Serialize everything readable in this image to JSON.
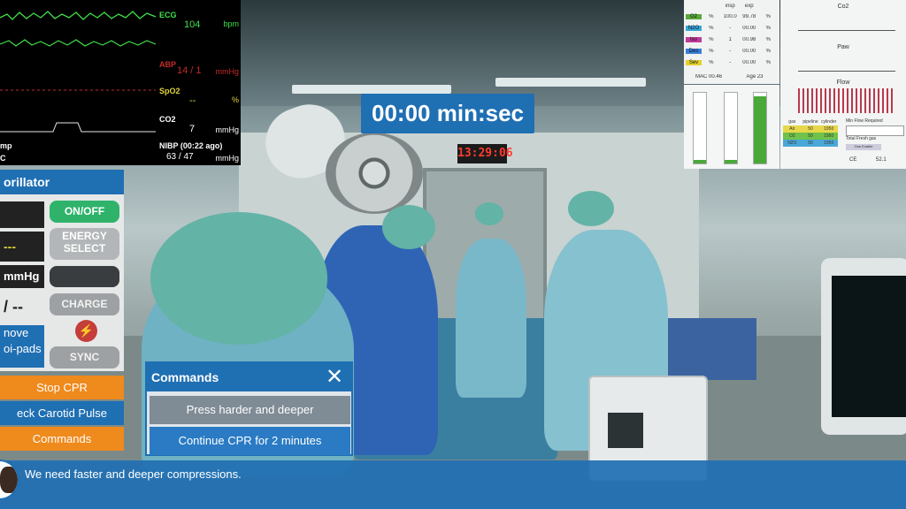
{
  "timer": {
    "text": "00:00 min:sec"
  },
  "wall_clock": "13:29:06",
  "patient_monitor": {
    "ecg": {
      "label": "ECG",
      "value": "104",
      "unit": "bpm"
    },
    "abp": {
      "label": "ABP",
      "value": "14 / 1",
      "unit": "mmHg"
    },
    "spo2": {
      "label": "SpO2",
      "value": "--",
      "unit": "%"
    },
    "co2": {
      "label": "CO2",
      "value": "7",
      "unit": "mmHg"
    },
    "nibp": {
      "label": "NIBP (00:22 ago)",
      "value": "63 / 47",
      "unit": "mmHg"
    },
    "left_cut_1": "mp",
    "left_cut_2": "C"
  },
  "gas_table": {
    "headers": [
      "",
      "",
      "insp",
      "exp",
      ""
    ],
    "rows": [
      {
        "gas": "O2",
        "unit": "%",
        "insp": "100.0",
        "exp": "99.78",
        "unit2": "%",
        "color": "#5aa83c"
      },
      {
        "gas": "N2O",
        "unit": "%",
        "insp": "-",
        "exp": "00.00",
        "unit2": "%",
        "color": "#3aa6d8"
      },
      {
        "gas": "Iso",
        "unit": "%",
        "insp": "1",
        "exp": "00.98",
        "unit2": "%",
        "color": "#c13a9c"
      },
      {
        "gas": "Des",
        "unit": "%",
        "insp": "-",
        "exp": "00.00",
        "unit2": "%",
        "color": "#3a7fd8"
      },
      {
        "gas": "Sev",
        "unit": "%",
        "insp": "-",
        "exp": "00.00",
        "unit2": "%",
        "color": "#e3d22a"
      }
    ],
    "mac": "MAC  00.46",
    "age": "Age  23"
  },
  "gas_bars": [
    0.05,
    0.05,
    0.95
  ],
  "ventilator": {
    "co2_label": "Co2",
    "paw_label": "Paw",
    "flow_label": "Flow",
    "table_headers": [
      "gas",
      "pipeline",
      "cylinder"
    ],
    "table_rows": [
      [
        "Air",
        "50",
        "1950"
      ],
      [
        "O2",
        "50",
        "1950"
      ],
      [
        "N2O",
        "50",
        "1950"
      ]
    ],
    "fresh_gas_title": "Min Flow Required",
    "fresh_gas_total": "Total Fresh gas",
    "fresh_gas_button": "Gas Enable",
    "footer_left": "CE",
    "footer_right": "52.1"
  },
  "defibrillator": {
    "title": "orillator",
    "display_1": "",
    "display_2": "---",
    "display_3": "mmHg",
    "display_4": "/ --",
    "display_5": "nove",
    "display_6": "oi-pads",
    "on_off": "ON/OFF",
    "energy_select": "ENERGY\nSELECT",
    "charge": "CHARGE",
    "shock_icon": "⚡",
    "sync": "SYNC"
  },
  "actions": {
    "stop_cpr": "Stop CPR",
    "check_carotid": "eck Carotid Pulse",
    "commands": "Commands"
  },
  "commands_popup": {
    "title": "Commands",
    "close": "✕",
    "items": [
      "Press harder and deeper",
      "Continue CPR for 2 minutes"
    ]
  },
  "dialog": {
    "text": "We need faster and deeper compressions."
  },
  "colors": {
    "ui_blue": "#1f6fb3",
    "orange": "#ef8a1d",
    "green": "#2fb36b"
  }
}
